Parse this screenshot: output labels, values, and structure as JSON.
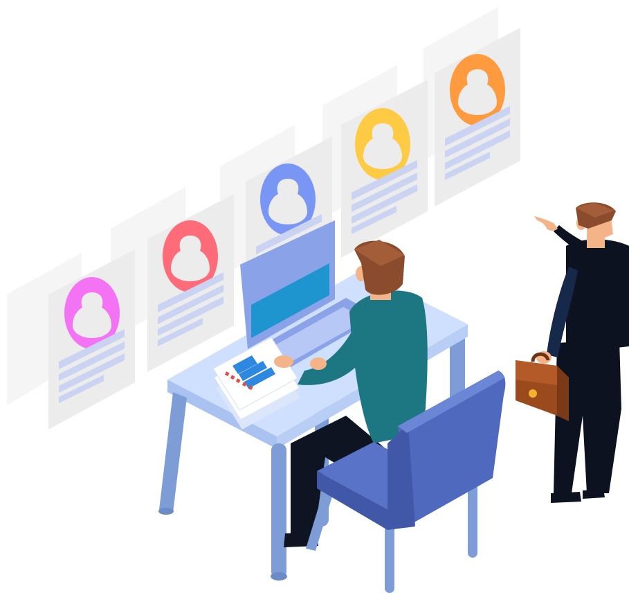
{
  "illustration": {
    "cards": [
      {
        "id": "card-1",
        "color": "#F472F4"
      },
      {
        "id": "card-2",
        "color": "#FF6B78"
      },
      {
        "id": "card-3",
        "color": "#7A96F5"
      },
      {
        "id": "card-4",
        "color": "#FFCB45"
      },
      {
        "id": "card-5",
        "color": "#FF9A3E"
      }
    ],
    "palette": {
      "card_back": "#F5F5F5",
      "card_front": "#ECECEC",
      "card_lines": "#CAD3F2",
      "desk_top": "#CFE0FF",
      "desk_edge": "#A9C2F0",
      "desk_legs": "#7E9DD6",
      "laptop_body": "#8AA3E8",
      "laptop_screen": "#1F95D0",
      "chair": "#5873C8",
      "chair_dark": "#4158A8",
      "shirt": "#1C7783",
      "hair": "#8B4C2E",
      "skin": "#F4B487",
      "suit": "#0D1220",
      "briefcase": "#9B4A1E",
      "briefcase_lock": "#F2B12E"
    }
  }
}
